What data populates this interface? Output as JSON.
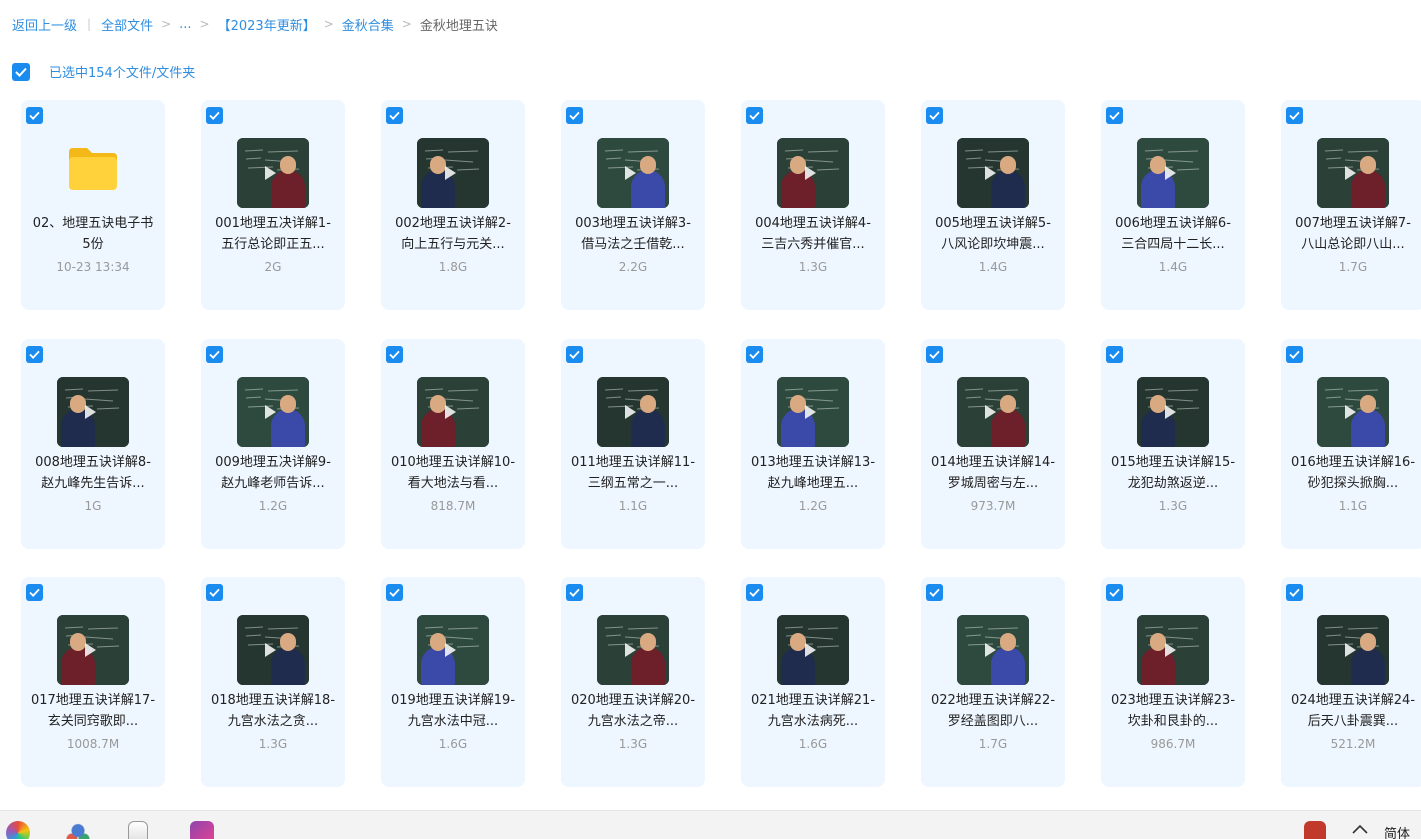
{
  "breadcrumb": {
    "back": "返回上一级",
    "items": [
      "全部文件",
      "...",
      "【2023年更新】",
      "金秋合集"
    ],
    "current": "金秋地理五诀"
  },
  "selection": {
    "text": "已选中154个文件/文件夹"
  },
  "colors": {
    "accent": "#1a8cf0",
    "card_bg": "#eef6ff",
    "link": "#2f8ee0"
  },
  "files": [
    {
      "type": "folder",
      "name": "02、地理五诀电子书5份",
      "meta": "10-23 13:34",
      "icon": "folder-icon"
    },
    {
      "type": "video",
      "name": "001地理五决详解1-五行总论即正五...",
      "meta": "2G"
    },
    {
      "type": "video",
      "name": "002地理五诀详解2-向上五行与元关...",
      "meta": "1.8G"
    },
    {
      "type": "video",
      "name": "003地理五诀详解3-借马法之壬借乾...",
      "meta": "2.2G"
    },
    {
      "type": "video",
      "name": "004地理五诀详解4-三吉六秀并催官...",
      "meta": "1.3G"
    },
    {
      "type": "video",
      "name": "005地理五诀详解5-八风论即坎坤震...",
      "meta": "1.4G"
    },
    {
      "type": "video",
      "name": "006地理五诀详解6-三合四局十二长...",
      "meta": "1.4G"
    },
    {
      "type": "video",
      "name": "007地理五诀详解7-八山总论即八山...",
      "meta": "1.7G"
    },
    {
      "type": "video",
      "name": "008地理五诀详解8-赵九峰先生告诉...",
      "meta": "1G"
    },
    {
      "type": "video",
      "name": "009地理五决详解9-赵九峰老师告诉...",
      "meta": "1.2G"
    },
    {
      "type": "video",
      "name": "010地理五诀详解10-看大地法与看...",
      "meta": "818.7M"
    },
    {
      "type": "video",
      "name": "011地理五诀详解11-三纲五常之一...",
      "meta": "1.1G"
    },
    {
      "type": "video",
      "name": "013地理五诀详解13-赵九峰地理五...",
      "meta": "1.2G"
    },
    {
      "type": "video",
      "name": "014地理五诀详解14-罗城周密与左...",
      "meta": "973.7M"
    },
    {
      "type": "video",
      "name": "015地理五诀详解15-龙犯劫煞返逆...",
      "meta": "1.3G"
    },
    {
      "type": "video",
      "name": "016地理五诀详解16-砂犯探头掀胸...",
      "meta": "1.1G"
    },
    {
      "type": "video",
      "name": "017地理五诀详解17-玄关同窍歌即...",
      "meta": "1008.7M"
    },
    {
      "type": "video",
      "name": "018地理五诀详解18-九宫水法之贪...",
      "meta": "1.3G"
    },
    {
      "type": "video",
      "name": "019地理五诀详解19-九宫水法中冠...",
      "meta": "1.6G"
    },
    {
      "type": "video",
      "name": "020地理五诀详解20-九宫水法之帝...",
      "meta": "1.3G"
    },
    {
      "type": "video",
      "name": "021地理五诀详解21-九宫水法病死...",
      "meta": "1.6G"
    },
    {
      "type": "video",
      "name": "022地理五诀详解22-罗经盖图即八...",
      "meta": "1.7G"
    },
    {
      "type": "video",
      "name": "023地理五诀详解23-坎卦和艮卦的...",
      "meta": "986.7M"
    },
    {
      "type": "video",
      "name": "024地理五诀详解24-后天八卦震巽...",
      "meta": "521.2M"
    }
  ],
  "taskbar": {
    "icons": [
      "color-wheel-icon",
      "network-icon",
      "notepad-icon",
      "mountain-app-icon"
    ],
    "right_label": "简体"
  }
}
